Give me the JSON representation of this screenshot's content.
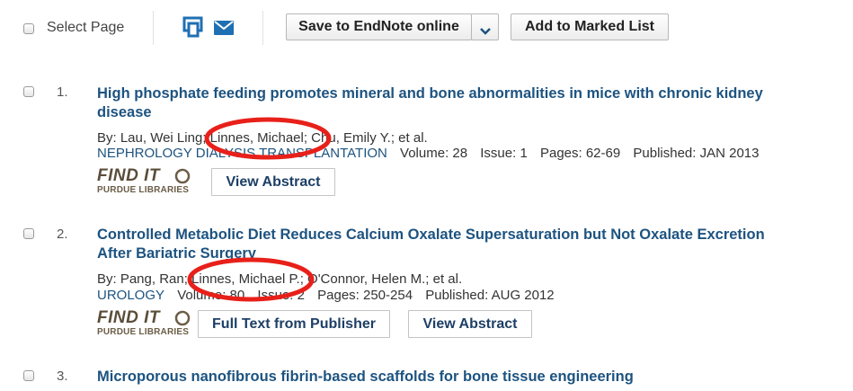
{
  "toolbar": {
    "select_page_label": "Select Page",
    "save_endnote_label": "Save to EndNote online",
    "add_marked_label": "Add to Marked List"
  },
  "records": [
    {
      "number": "1.",
      "title_line1": "High phosphate feeding promotes mineral and bone abnormalities in mice with chronic kidney",
      "title_line2": "disease",
      "authors": "By: Lau, Wei Ling; Linnes, Michael; Chu, Emily Y.; et al.",
      "journal": "NEPHROLOGY DIALYSIS TRANSPLANTATION",
      "volume": "Volume: 28",
      "issue": "Issue: 1",
      "pages": "Pages: 62-69",
      "published": "Published: JAN 2013",
      "findit_top": "FIND IT",
      "findit_bottom": "PURDUE LIBRARIES",
      "view_abstract_label": "View Abstract"
    },
    {
      "number": "2.",
      "title_line1": "Controlled Metabolic Diet Reduces Calcium Oxalate Supersaturation but Not Oxalate Excretion",
      "title_line2": "After Bariatric Surgery",
      "authors": "By: Pang, Ran; Linnes, Michael P.; O'Connor, Helen M.; et al.",
      "journal": "UROLOGY",
      "volume": "Volume: 80",
      "issue": "Issue: 2",
      "pages": "Pages: 250-254",
      "published": "Published: AUG 2012",
      "findit_top": "FIND IT",
      "findit_bottom": "PURDUE LIBRARIES",
      "full_text_label": "Full Text from Publisher",
      "view_abstract_label": "View Abstract"
    },
    {
      "number": "3.",
      "title_line1": "Microporous nanofibrous fibrin-based scaffolds for bone tissue engineering"
    }
  ],
  "colors": {
    "link_blue": "#1d5380",
    "highlight_red": "#e8201a"
  }
}
